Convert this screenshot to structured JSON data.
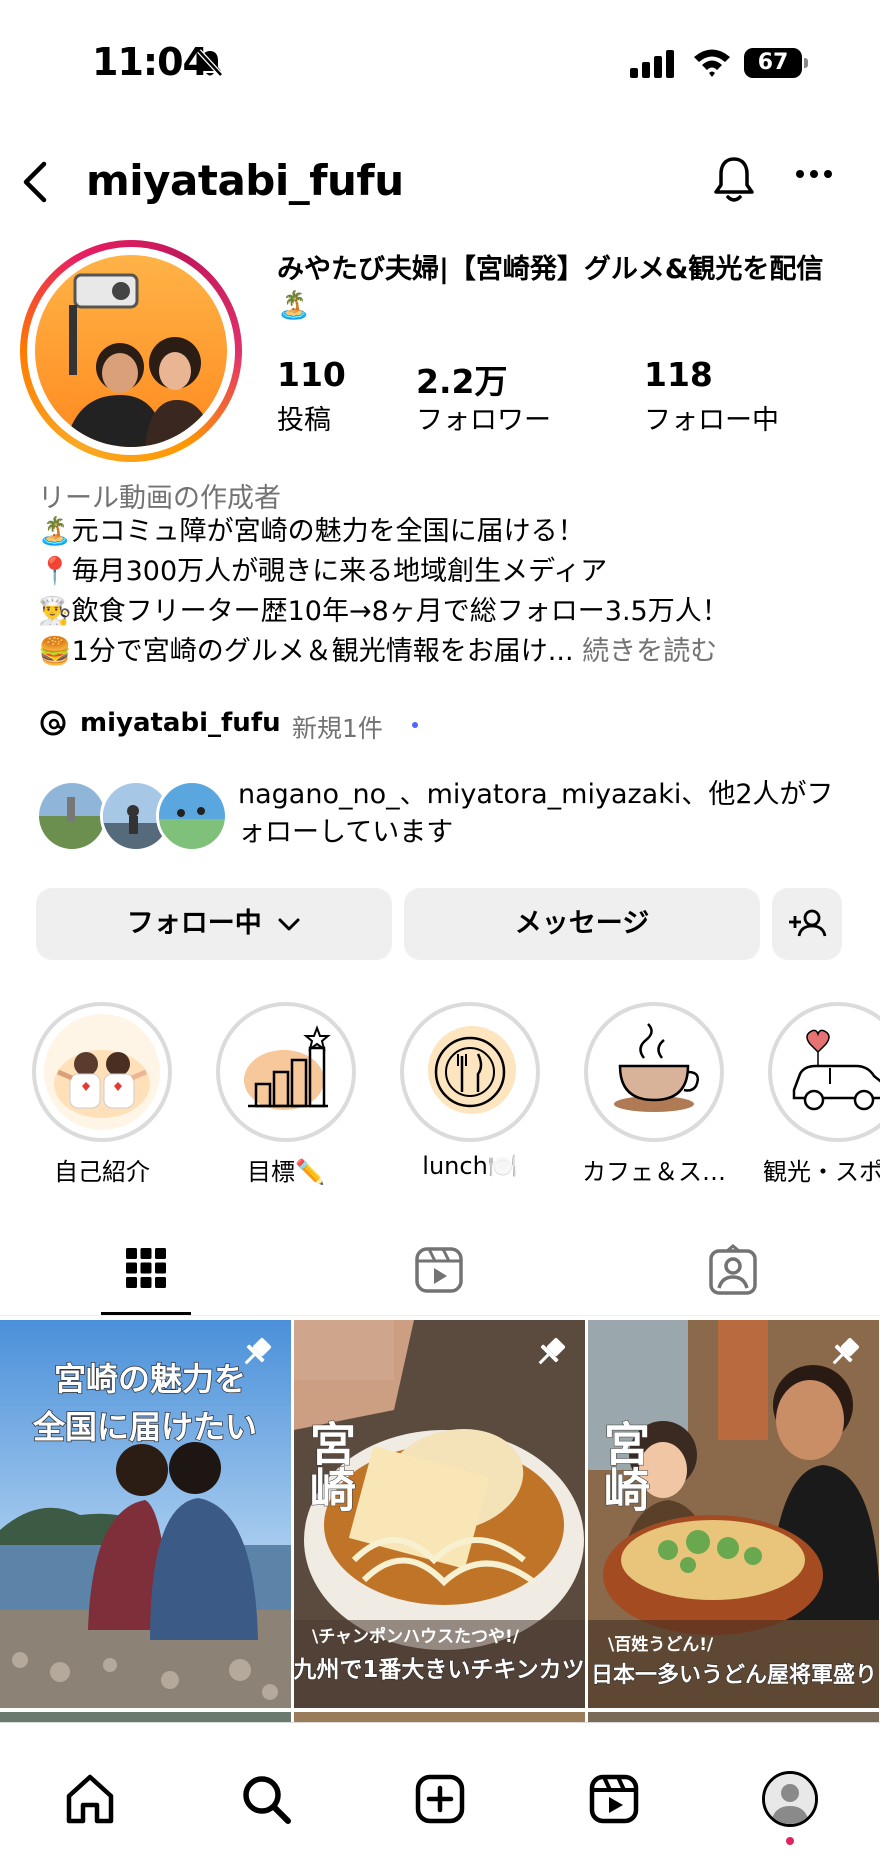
{
  "status_bar": {
    "time": "11:04",
    "battery": "67"
  },
  "header": {
    "username": "miyatabi_fufu"
  },
  "profile": {
    "display_name": "みやたび夫婦|【宮崎発】グルメ&観光を配信🏝️",
    "stats": [
      {
        "value": "110",
        "label": "投稿"
      },
      {
        "value": "2.2万",
        "label": "フォロワー"
      },
      {
        "value": "118",
        "label": "フォロー中"
      }
    ],
    "category": "リール動画の作成者",
    "bio_lines": [
      "🏝️元コミュ障が宮崎の魅力を全国に届ける！",
      "📍毎月300万人が覗きに来る地域創生メディア",
      "👨‍🍳飲食フリーター歴10年→8ヶ月で総フォロー3.5万人！",
      "🍔1分で宮崎のグルメ＆観光情報をお届け..."
    ],
    "more_label": "続きを読む",
    "threads_username": "miyatabi_fufu",
    "threads_new": "新規1件",
    "mutual_text": "nagano_no_、miyatora_miyazaki、他2人がフォローしています"
  },
  "buttons": {
    "following": "フォロー中",
    "message": "メッセージ"
  },
  "highlights": [
    {
      "label": "自己紹介",
      "icon": "couple-illustration"
    },
    {
      "label": "目標✏️",
      "icon": "goal-chart-illustration"
    },
    {
      "label": "lunch🍽️",
      "icon": "fork-knife-plate-icon"
    },
    {
      "label": "カフェ＆ス…",
      "icon": "coffee-cup-icon"
    },
    {
      "label": "観光・スポ",
      "icon": "car-heart-icon"
    }
  ],
  "tabs": [
    {
      "name": "grid-tab",
      "icon": "grid-icon",
      "active": true
    },
    {
      "name": "reels-tab",
      "icon": "reels-icon",
      "active": false
    },
    {
      "name": "tagged-tab",
      "icon": "tagged-icon",
      "active": false
    }
  ],
  "posts": [
    {
      "line1": "宮崎の魅力を",
      "line2": "全国に届けたい",
      "pinned": true
    },
    {
      "vertical": "宮崎",
      "subtitle": "\\チャンポンハウスたつや!/",
      "caption": "九州で1番大きいチキンカツ",
      "pinned": true
    },
    {
      "vertical": "宮崎",
      "subtitle": "\\百姓うどん!/",
      "caption": "日本一多いうどん屋将軍盛り",
      "pinned": true
    }
  ],
  "bottom_nav": [
    {
      "name": "home",
      "icon": "home-icon"
    },
    {
      "name": "search",
      "icon": "search-icon"
    },
    {
      "name": "create",
      "icon": "plus-square-icon"
    },
    {
      "name": "reels",
      "icon": "reels-icon"
    },
    {
      "name": "profile",
      "icon": "profile-avatar"
    }
  ],
  "colors": {
    "secondary_text": "#737373",
    "button_bg": "#efefef",
    "notification_dot": "#e0245e",
    "threads_dot": "#4d66ff"
  }
}
